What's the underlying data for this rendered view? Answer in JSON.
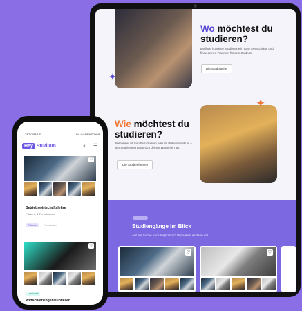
{
  "tablet": {
    "section1": {
      "title_accent": "Wo",
      "title_rest": "möchtest du studieren?",
      "description": "Entfinde hunderte Studienorte in ganz Deutschland und finde deinen Traumort für dein Studium.",
      "button": "Die Stadtsuche"
    },
    "section2": {
      "title_accent": "Wie",
      "title_rest": "möchtest du studieren?",
      "description": "Betriebsw. ist zum Fernstudium oder im Präsenzstudium – der Studienweg passt sich deinen Wünschen an.",
      "button": "Die Studienformen"
    },
    "programs": {
      "title": "Studiengänge im Blick",
      "subtitle": "Auf der Suche nach Inspiration? Wir sehen es dann mit ..."
    }
  },
  "phone": {
    "status_left": "ZET.GRAZ.E",
    "status_right": "DA.WARENSONNE",
    "logo_hey": "Hey",
    "logo_studium": "Studium",
    "card1": {
      "title": "Betriebswirtschaftslehre",
      "subtitle": "Präsenz & Fernstudium",
      "tag1": "Präsenz",
      "tag2": "Fernstudium"
    },
    "card2": {
      "badge": "Lerninhalt",
      "title": "Wirtschaftsingenieurwesen"
    }
  },
  "colors": {
    "background": "#8a6ee6",
    "accent_purple": "#5a4bd6",
    "accent_orange": "#f07a3a"
  }
}
